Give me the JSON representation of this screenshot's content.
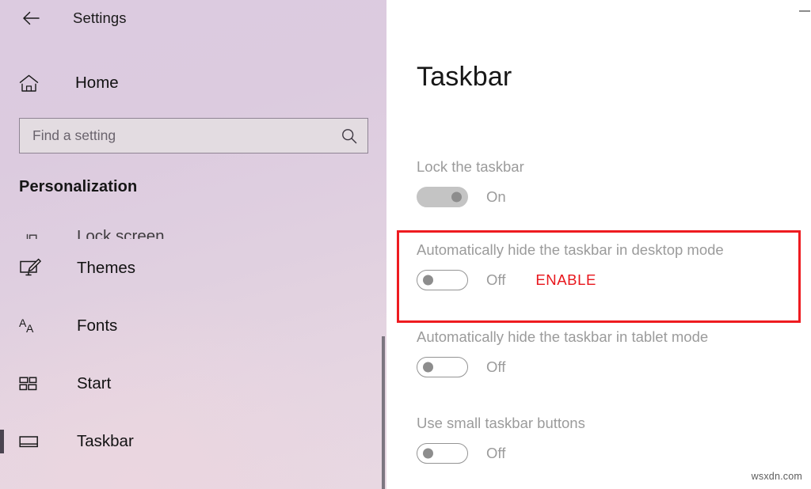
{
  "window": {
    "title": "Settings",
    "back_icon": "back-arrow-icon",
    "minimize_icon": "minimize-icon"
  },
  "sidebar": {
    "home": {
      "label": "Home",
      "icon": "home-icon"
    },
    "search": {
      "value": "",
      "placeholder": "Find a setting",
      "icon": "search-icon"
    },
    "section_heading": "Personalization",
    "items": [
      {
        "label": "Lock screen",
        "icon": "lock-screen-icon",
        "selected": false,
        "clipped": true
      },
      {
        "label": "Themes",
        "icon": "themes-icon",
        "selected": false,
        "clipped": false
      },
      {
        "label": "Fonts",
        "icon": "fonts-icon",
        "selected": false,
        "clipped": false
      },
      {
        "label": "Start",
        "icon": "start-icon",
        "selected": false,
        "clipped": false
      },
      {
        "label": "Taskbar",
        "icon": "taskbar-icon",
        "selected": true,
        "clipped": false
      }
    ],
    "scrollbar": {
      "name": "sidebar-scrollbar"
    }
  },
  "main": {
    "page_title": "Taskbar",
    "settings": [
      {
        "label": "Lock the taskbar",
        "state": "On",
        "toggle": "on",
        "annotation": ""
      },
      {
        "label": "Automatically hide the taskbar in desktop mode",
        "state": "Off",
        "toggle": "off",
        "annotation": "ENABLE"
      },
      {
        "label": "Automatically hide the taskbar in tablet mode",
        "state": "Off",
        "toggle": "off",
        "annotation": ""
      },
      {
        "label": "Use small taskbar buttons",
        "state": "Off",
        "toggle": "off",
        "annotation": ""
      }
    ],
    "highlight": {
      "target": "Automatically hide the taskbar in desktop mode"
    }
  },
  "watermark": "wsxdn.com",
  "colors": {
    "sidebar_top": "#dccbe0",
    "sidebar_bottom": "#e8d8e2",
    "accent_red": "#ee1b20",
    "label_gray": "#9b9b9b",
    "selection_bar": "#4a4450"
  }
}
